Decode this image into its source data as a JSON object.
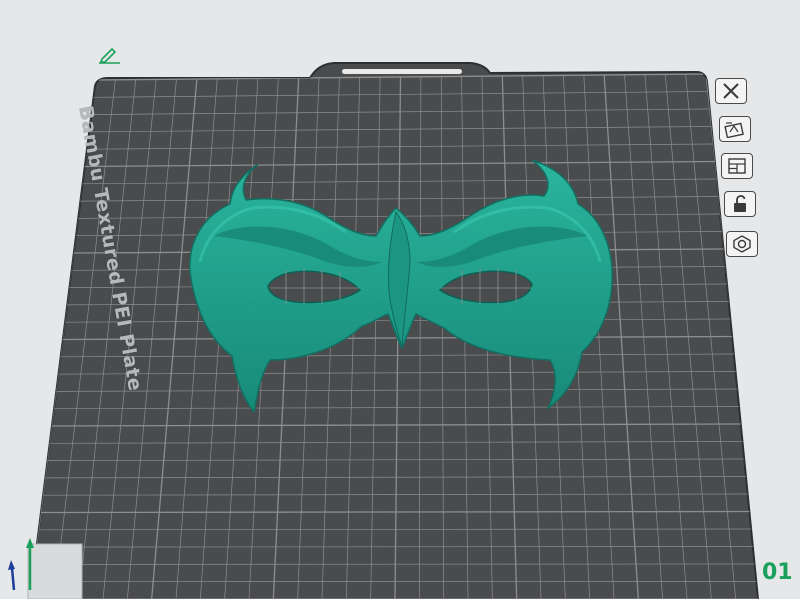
{
  "plate": {
    "name": "Bambu Textured PEI Plate",
    "number": "01",
    "grid_color": "#8c8e90",
    "surface_color": "#4a4b4d"
  },
  "model": {
    "color": "#1fa18c",
    "shade_color": "#157a6a"
  },
  "toolbar": {
    "buttons": [
      {
        "name": "close-icon"
      },
      {
        "name": "plate-settings-icon"
      },
      {
        "name": "arrange-icon"
      },
      {
        "name": "lock-icon"
      },
      {
        "name": "plate-gear-icon"
      }
    ]
  },
  "colors": {
    "accent_green": "#1aa05a",
    "background": "#e6e7e9"
  }
}
